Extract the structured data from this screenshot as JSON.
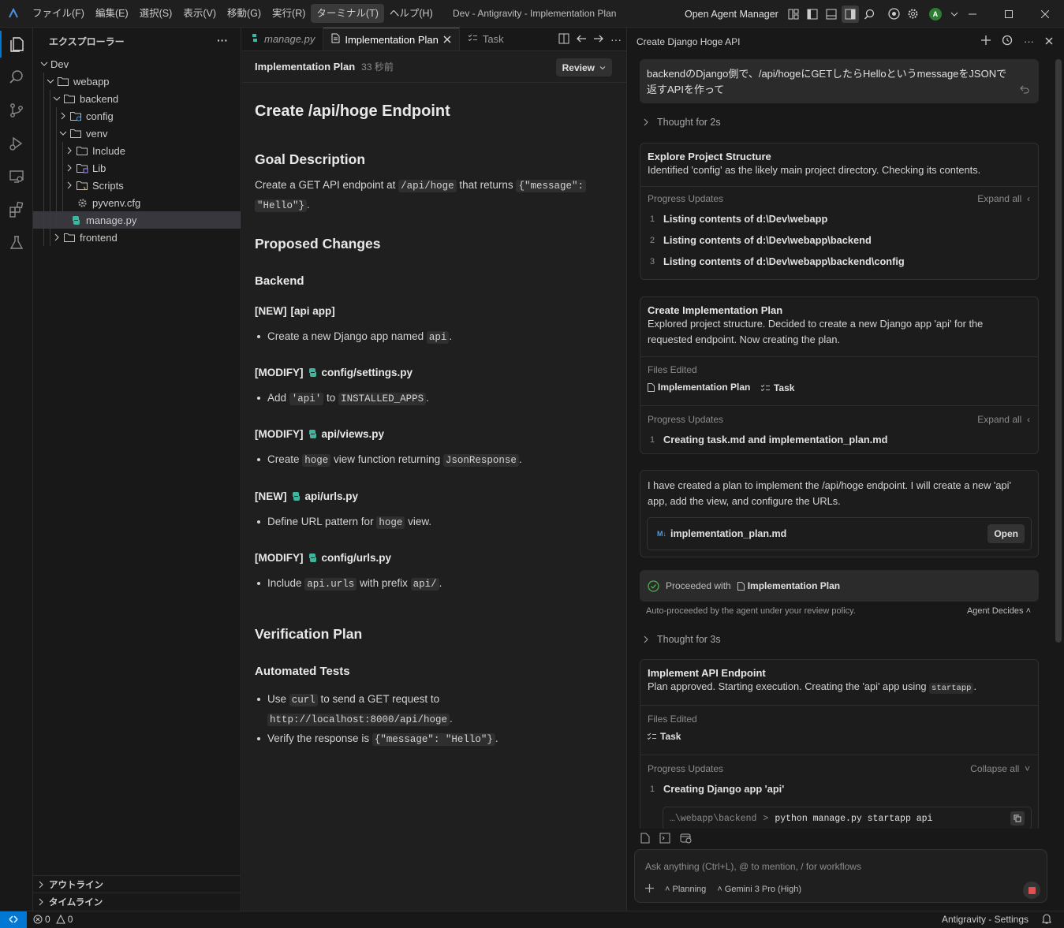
{
  "titlebar": {
    "menu": [
      "ファイル(F)",
      "編集(E)",
      "選択(S)",
      "表示(V)",
      "移動(G)",
      "実行(R)",
      "ターミナル(T)",
      "ヘルプ(H)"
    ],
    "window_title": "Dev - Antigravity - Implementation Plan",
    "open_agent_manager": "Open Agent Manager",
    "avatar_letter": "A"
  },
  "sidebar": {
    "title": "エクスプローラー",
    "tree": [
      {
        "label": "Dev",
        "depth": 0,
        "type": "folder-open"
      },
      {
        "label": "webapp",
        "depth": 1,
        "type": "folder-open"
      },
      {
        "label": "backend",
        "depth": 2,
        "type": "folder-open"
      },
      {
        "label": "config",
        "depth": 3,
        "type": "folder-closed",
        "icon": "config-folder-icon"
      },
      {
        "label": "venv",
        "depth": 3,
        "type": "folder-open"
      },
      {
        "label": "Include",
        "depth": 4,
        "type": "folder-closed"
      },
      {
        "label": "Lib",
        "depth": 4,
        "type": "folder-closed",
        "icon": "lib-folder-icon"
      },
      {
        "label": "Scripts",
        "depth": 4,
        "type": "folder-closed",
        "icon": "scripts-folder-icon"
      },
      {
        "label": "pyvenv.cfg",
        "depth": 4,
        "type": "file",
        "icon": "gear-file-icon"
      },
      {
        "label": "manage.py",
        "depth": 3,
        "type": "file",
        "icon": "python-icon",
        "selected": true
      },
      {
        "label": "frontend",
        "depth": 2,
        "type": "folder-closed"
      }
    ],
    "outline_label": "アウトライン",
    "timeline_label": "タイムライン"
  },
  "editor": {
    "tabs": [
      {
        "label": "manage.py",
        "icon": "python-icon",
        "italic": true
      },
      {
        "label": "Implementation Plan",
        "icon": "document-icon",
        "active": true
      },
      {
        "label": "Task",
        "icon": "checklist-icon"
      }
    ],
    "doc_title": "Implementation Plan",
    "doc_time": "33 秒前",
    "review_label": "Review",
    "h1": "Create /api/hoge Endpoint",
    "goal_heading": "Goal Description",
    "goal_text": {
      "a": "Create a GET API endpoint at ",
      "b": "/api/hoge",
      "c": " that returns ",
      "d": "{\"message\":",
      "e": "\"Hello\"}",
      "f": "."
    },
    "proposed_heading": "Proposed Changes",
    "backend_heading": "Backend",
    "sections": [
      {
        "tag": "[NEW]",
        "name": "[api app]",
        "icon": false,
        "bullet": {
          "a": "Create a new Django app named ",
          "code": "api",
          "c": "."
        }
      },
      {
        "tag": "[MODIFY]",
        "name": "config/settings.py",
        "icon": true,
        "bullet": {
          "a": "Add ",
          "code": "'api'",
          "c": " to ",
          "code2": "INSTALLED_APPS",
          "d": "."
        }
      },
      {
        "tag": "[MODIFY]",
        "name": "api/views.py",
        "icon": true,
        "bullet": {
          "a": "Create ",
          "code": "hoge",
          "c": " view function returning ",
          "code2": "JsonResponse",
          "d": "."
        }
      },
      {
        "tag": "[NEW]",
        "name": "api/urls.py",
        "icon": true,
        "bullet": {
          "a": "Define URL pattern for ",
          "code": "hoge",
          "c": " view."
        }
      },
      {
        "tag": "[MODIFY]",
        "name": "config/urls.py",
        "icon": true,
        "bullet": {
          "a": "Include ",
          "code": "api.urls",
          "c": " with prefix ",
          "code2": "api/",
          "d": "."
        }
      }
    ],
    "verification_heading": "Verification Plan",
    "automated_heading": "Automated Tests",
    "tests": [
      {
        "a": "Use ",
        "code": "curl",
        "c": " to send a GET request to ",
        "code2": "http://localhost:8000/api/hoge",
        "d": "."
      },
      {
        "a": "Verify the response is ",
        "code": "{\"message\": \"Hello\"}",
        "c": "."
      }
    ]
  },
  "agent": {
    "title": "Create Django Hoge API",
    "user_message_line1": "backendのDjango側で、/api/hogeにGETしたらHelloというmessageをJSONで",
    "user_message_line2": "返すAPIを作って",
    "thought1": "Thought for 2s",
    "card1": {
      "title": "Explore Project Structure",
      "text": "Identified 'config' as the likely main project directory. Checking its contents.",
      "progress_label": "Progress Updates",
      "expand_label": "Expand all",
      "items": [
        "Listing contents of d:\\Dev\\webapp",
        "Listing contents of d:\\Dev\\webapp\\backend",
        "Listing contents of d:\\Dev\\webapp\\backend\\config"
      ]
    },
    "card2": {
      "title": "Create Implementation Plan",
      "text_line1": "Explored project structure. Decided to create a new Django app 'api' for the",
      "text_line2": "requested endpoint. Now creating the plan.",
      "files_label": "Files Edited",
      "files": [
        "Implementation Plan",
        "Task"
      ],
      "progress_label": "Progress Updates",
      "expand_label": "Expand all",
      "items": [
        "Creating task.md and implementation_plan.md"
      ]
    },
    "card3": {
      "text_line1": "I have created a plan to implement the /api/hoge endpoint. I will create a new 'api'",
      "text_line2": "app, add the view, and configure the URLs.",
      "file_name": "implementation_plan.md",
      "open_label": "Open"
    },
    "proceeded": {
      "prefix": "Proceeded with",
      "doc": "Implementation Plan"
    },
    "auto_note": "Auto-proceeded by the agent under your review policy.",
    "agent_decides": "Agent Decides",
    "thought2": "Thought for 3s",
    "card4": {
      "title": "Implement API Endpoint",
      "text": "Plan approved. Starting execution. Creating the 'api' app using ",
      "code": "startapp",
      "text_end": ".",
      "files_label": "Files Edited",
      "files": [
        "Task"
      ],
      "progress_label": "Progress Updates",
      "collapse_label": "Collapse all",
      "items": [
        "Creating Django app 'api'"
      ],
      "cmd_path": "…\\webapp\\backend",
      "cmd": "python manage.py startapp api"
    },
    "input_placeholder": "Ask anything (Ctrl+L), @ to mention, / for workflows",
    "mode_label": "Planning",
    "model_label": "Gemini 3 Pro (High)"
  },
  "statusbar": {
    "errors": "0",
    "warnings": "0",
    "right_label": "Antigravity - Settings"
  },
  "colors": {
    "accent": "#0078d4",
    "python": "#3fb5a0",
    "success": "#4caf50",
    "stop": "#e05252"
  }
}
